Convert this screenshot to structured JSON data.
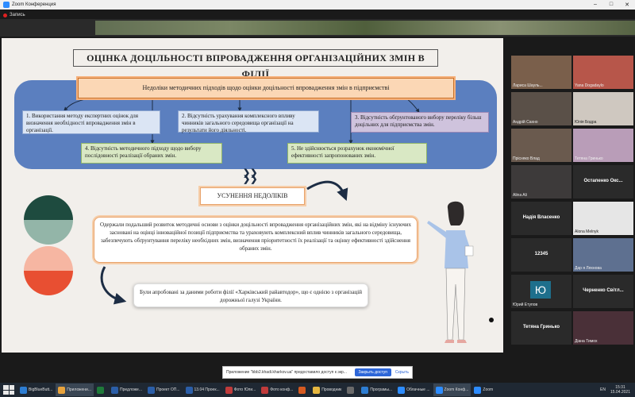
{
  "window": {
    "title": "Zoom Конференция",
    "controls": [
      "–",
      "□",
      "✕"
    ]
  },
  "recording": {
    "label": "Запись"
  },
  "slide": {
    "title": "ОЦІНКА ДОЦІЛЬНОСТІ ВПРОВАДЖЕННЯ ОРГАНІЗАЦІЙНИХ ЗМІН В ФІЛІЇ",
    "header_box": "Недоліки методичних підходів щодо оцінки доцільності впровадження змін в підприємстві",
    "boxes": [
      "1. Використання методу експертних оцінок для визначення необхідності впровадження змін в організації.",
      "2. Відсутність урахування комплексного впливу чинників загального середовища організації на результати його діяльності.",
      "3. Відсутність обґрунтованого вибору переліку більш доцільних для підприємства змін.",
      "4. Відсутність методичного підходу щодо вибору послідовності реалізації обраних змін.",
      "5. Не здійснюється розрахунок економічної ефективності запропонованих змін."
    ],
    "chevrons": "❯❯\n❯❯",
    "elimination_label": "УСУНЕННЯ НЕДОЛІКІВ",
    "main_text": "Одержали подальший розвиток методичні основи з оцінки доцільності впровадження організаційних змін, які на відміну існуючих засновані на оцінці інноваційної позиції підприємства та ураховують комплексний вплив чинників загального середовища, забезпечують обґрунтування переліку необхідних змін, визначення пріоритетності їх реалізації та оцінку ефективності здійснення обраних змін.",
    "bottom_text": "Були апробовані за даними роботи філії «Харківський райавтодор», що є однією з організацій дорожньої галузі України.",
    "colors": {
      "panel": "#5b7fbf",
      "header": "#fbd7b5",
      "box_blue": "#dbe5f4",
      "box_purple": "#cfc3dd",
      "box_green": "#d9e8c4",
      "accent_orange": "#e8a36c"
    }
  },
  "participants": [
    {
      "name": "Лариса Шауль...",
      "kind": "video",
      "photo": "#7a5f4b"
    },
    {
      "name": "Yana Dogadaylo",
      "kind": "video",
      "photo": "#b7564a"
    },
    {
      "name": "Андрій Сахно",
      "kind": "video",
      "photo": "#5a5048"
    },
    {
      "name": "Юлія Бодра",
      "kind": "video",
      "photo": "#cfc8c0",
      "active": true
    },
    {
      "name": "Прісняко Влад",
      "kind": "video",
      "photo": "#6a5a4e"
    },
    {
      "name": "Тетяна Гринько",
      "kind": "video",
      "photo": "#b99db8"
    },
    {
      "name": "Alina Ali",
      "kind": "video",
      "photo": "#3d3a3a"
    },
    {
      "name": "Остапенко Окс...",
      "kind": "text"
    },
    {
      "name": "Надія Власенко",
      "kind": "text"
    },
    {
      "name": "Alona Melnyk",
      "kind": "video",
      "photo": "#e6e6e6"
    },
    {
      "name": "12345",
      "kind": "text"
    },
    {
      "name": "Дар я Ляхнова",
      "kind": "video",
      "photo": "#5e7090"
    },
    {
      "name": "Юрий Етупов",
      "kind": "initial",
      "initial": "Ю"
    },
    {
      "name": "Черненко Світл...",
      "kind": "text"
    },
    {
      "name": "Тетяна Гринько",
      "kind": "text"
    },
    {
      "name": "Діана Тимох",
      "kind": "video",
      "photo": "#4a3038"
    }
  ],
  "share_prompt": {
    "text": "Приложение \"bbb2.khadi.kharkov.ua\" предоставило доступ к экр...",
    "allow_label": "Закрыть доступ",
    "hide_label": "Скрыть"
  },
  "taskbar": {
    "items": [
      {
        "label": "BigBlueButt...",
        "color": "#2d7dd2"
      },
      {
        "label": "Приложени...",
        "color": "#e8a33d",
        "selected": true
      },
      {
        "label": "",
        "color": "#1f7a3a"
      },
      {
        "label": "Предложе...",
        "color": "#2b5ea8"
      },
      {
        "label": "Проект ОП...",
        "color": "#2b5ea8"
      },
      {
        "label": "13.04 Проек...",
        "color": "#2b5ea8"
      },
      {
        "label": "Фото Юли...",
        "color": "#c03b3b"
      },
      {
        "label": "Фото конф...",
        "color": "#c03b3b"
      },
      {
        "label": "",
        "color": "#d65a20"
      },
      {
        "label": "Проводник",
        "color": "#e6b740"
      },
      {
        "label": "",
        "color": "#6a6a6a"
      },
      {
        "label": "Програмы...",
        "color": "#2d7dd2"
      },
      {
        "label": "Облачные ...",
        "color": "#2d8cff"
      },
      {
        "label": "Zoom Конф...",
        "color": "#2d8cff",
        "selected": true
      },
      {
        "label": "Zoom",
        "color": "#2d8cff"
      }
    ],
    "language": "EN",
    "time": "15:31",
    "date": "15.04.2021"
  }
}
